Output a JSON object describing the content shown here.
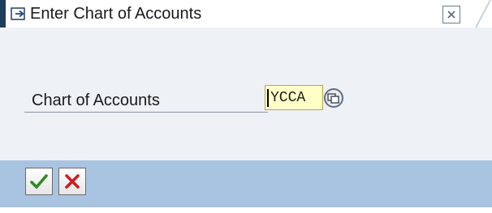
{
  "window": {
    "title": "Enter Chart of Accounts",
    "title_icon": "execute-icon",
    "close_icon": "close-icon"
  },
  "form": {
    "chart_of_accounts": {
      "label": "Chart of Accounts",
      "value": "YCCA",
      "value_help_icon": "value-help-icon"
    }
  },
  "toolbar": {
    "buttons": [
      {
        "name": "continue",
        "icon": "checkmark-icon",
        "color": "#2e8b1f"
      },
      {
        "name": "cancel",
        "icon": "x-icon",
        "color": "#d01c1c"
      }
    ]
  },
  "colors": {
    "title_accent": "#1f3d5c",
    "content_bg": "#eef1f5",
    "toolbar_bg": "#a9c4e1",
    "input_bg": "#ffffc8"
  }
}
